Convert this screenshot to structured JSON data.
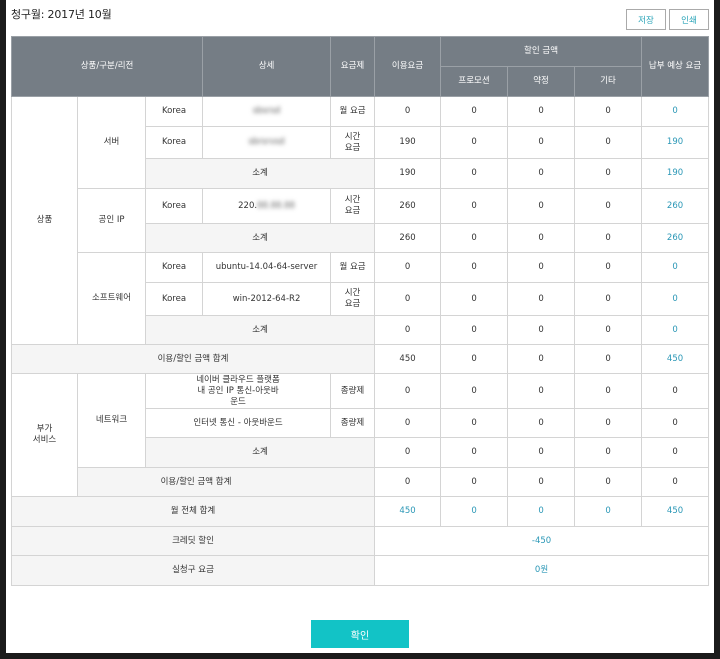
{
  "page": {
    "title": "청구월: 2017년 10월",
    "save_label": "저장",
    "print_label": "인쇄",
    "confirm_label": "확인"
  },
  "header": {
    "product_region": "상품/구분/리전",
    "detail": "상세",
    "plan": "요금제",
    "usage_fee": "이용요금",
    "discount": "할인 금액",
    "promotion": "프로모션",
    "contract": "약정",
    "other": "기타",
    "expected_payment": "납부 예상 요금"
  },
  "groups": {
    "product": "상품",
    "addon": "부가\n서비스",
    "server": "서버",
    "public_ip": "공인 IP",
    "software": "소프트웨어",
    "network": "네트워크"
  },
  "rows": {
    "server1": {
      "region": "Korea",
      "detail": "sbsrsd",
      "plan": "월 요금",
      "usage": "0",
      "promo": "0",
      "contract": "0",
      "other": "0",
      "total": "0"
    },
    "server2": {
      "region": "Korea",
      "detail": "sbrsrvsd",
      "plan": "시간\n요금",
      "usage": "190",
      "promo": "0",
      "contract": "0",
      "other": "0",
      "total": "190"
    },
    "server_sub": {
      "label": "소계",
      "usage": "190",
      "promo": "0",
      "contract": "0",
      "other": "0",
      "total": "190"
    },
    "ip1": {
      "region": "Korea",
      "detail_prefix": "220.",
      "detail_blur": "88.88.88",
      "plan": "시간\n요금",
      "usage": "260",
      "promo": "0",
      "contract": "0",
      "other": "0",
      "total": "260"
    },
    "ip_sub": {
      "label": "소계",
      "usage": "260",
      "promo": "0",
      "contract": "0",
      "other": "0",
      "total": "260"
    },
    "sw1": {
      "region": "Korea",
      "detail": "ubuntu-14.04-64-server",
      "plan": "월 요금",
      "usage": "0",
      "promo": "0",
      "contract": "0",
      "other": "0",
      "total": "0"
    },
    "sw2": {
      "region": "Korea",
      "detail": "win-2012-64-R2",
      "plan": "시간\n요금",
      "usage": "0",
      "promo": "0",
      "contract": "0",
      "other": "0",
      "total": "0"
    },
    "sw_sub": {
      "label": "소계",
      "usage": "0",
      "promo": "0",
      "contract": "0",
      "other": "0",
      "total": "0"
    },
    "product_total": {
      "label": "이용/할인 금액 합계",
      "usage": "450",
      "promo": "0",
      "contract": "0",
      "other": "0",
      "total": "450"
    },
    "net1": {
      "detail": "네이버 클라우드 플랫폼 내 공인 IP 통신-아웃바운드",
      "plan": "종량제",
      "usage": "0",
      "promo": "0",
      "contract": "0",
      "other": "0",
      "total": "0"
    },
    "net2": {
      "detail": "인터넷 통신 - 아웃바운드",
      "plan": "종량제",
      "usage": "0",
      "promo": "0",
      "contract": "0",
      "other": "0",
      "total": "0"
    },
    "net_sub": {
      "label": "소계",
      "usage": "0",
      "promo": "0",
      "contract": "0",
      "other": "0",
      "total": "0"
    },
    "addon_total": {
      "label": "이용/할인 금액 합계",
      "usage": "0",
      "promo": "0",
      "contract": "0",
      "other": "0",
      "total": "0"
    },
    "month_total": {
      "label": "월 전체 합계",
      "usage": "450",
      "promo": "0",
      "contract": "0",
      "other": "0",
      "total": "450"
    },
    "credit": {
      "label": "크레딧 할인",
      "value": "-450"
    },
    "actual": {
      "label": "실청구 요금",
      "value": "0원"
    }
  },
  "colors": {
    "header_bg": "#757d85",
    "accent_blue": "#2a97b6",
    "confirm_bg": "#12c3c6"
  }
}
